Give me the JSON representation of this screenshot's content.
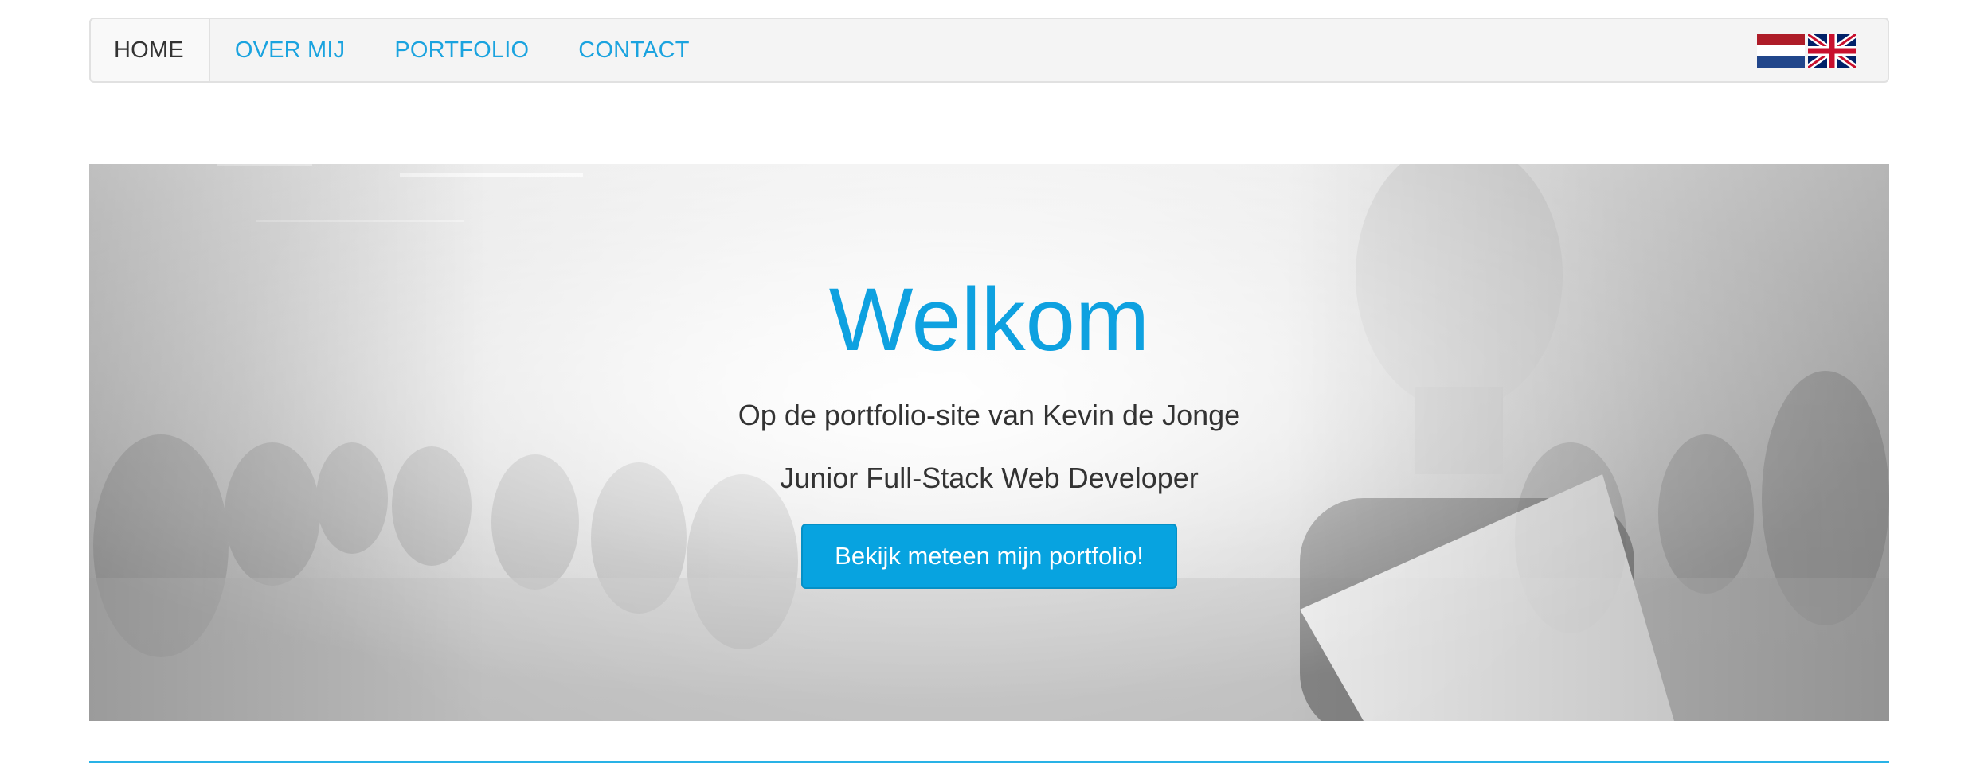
{
  "nav": {
    "items": [
      {
        "label": "HOME",
        "active": true
      },
      {
        "label": "OVER MIJ",
        "active": false
      },
      {
        "label": "PORTFOLIO",
        "active": false
      },
      {
        "label": "CONTACT",
        "active": false
      }
    ],
    "languages": [
      {
        "icon": "dutch-flag-icon",
        "colors": [
          "#ae1c28",
          "#ffffff",
          "#21468b"
        ]
      },
      {
        "icon": "uk-flag-icon",
        "colors": [
          "#012169",
          "#ffffff",
          "#c8102e"
        ]
      }
    ]
  },
  "hero": {
    "title": "Welkom",
    "subtitle": "Op de portfolio-site van Kevin de Jonge",
    "role": "Junior Full-Stack Web Developer",
    "cta_label": "Bekijk meteen mijn portfolio!"
  },
  "colors": {
    "accent": "#0ea1e0",
    "nav_link": "#1aa3df",
    "divider": "#29b2e6",
    "text": "#333333"
  }
}
